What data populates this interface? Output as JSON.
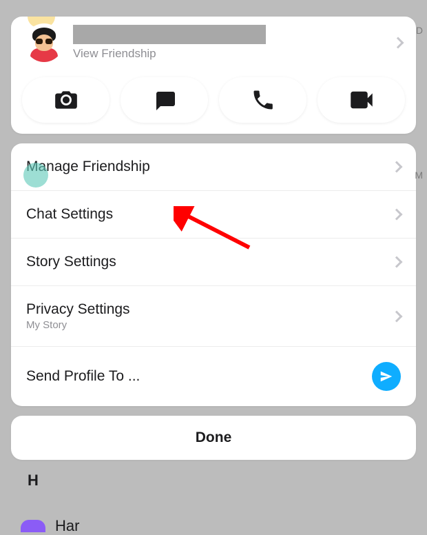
{
  "profile": {
    "view_friendship_label": "View Friendship"
  },
  "actions": {
    "camera": "camera",
    "chat": "chat",
    "call": "call",
    "video": "video"
  },
  "settings": [
    {
      "title": "Manage Friendship",
      "subtitle": ""
    },
    {
      "title": "Chat Settings",
      "subtitle": ""
    },
    {
      "title": "Story Settings",
      "subtitle": ""
    },
    {
      "title": "Privacy Settings",
      "subtitle": "My Story"
    },
    {
      "title": "Send Profile To ...",
      "subtitle": ""
    }
  ],
  "done_label": "Done",
  "background": {
    "letter_d": "D",
    "letter_m": "M",
    "letter_h": "H",
    "partial_name": "Har"
  },
  "colors": {
    "send_button": "#0fadff",
    "arrow": "#ff0000"
  }
}
